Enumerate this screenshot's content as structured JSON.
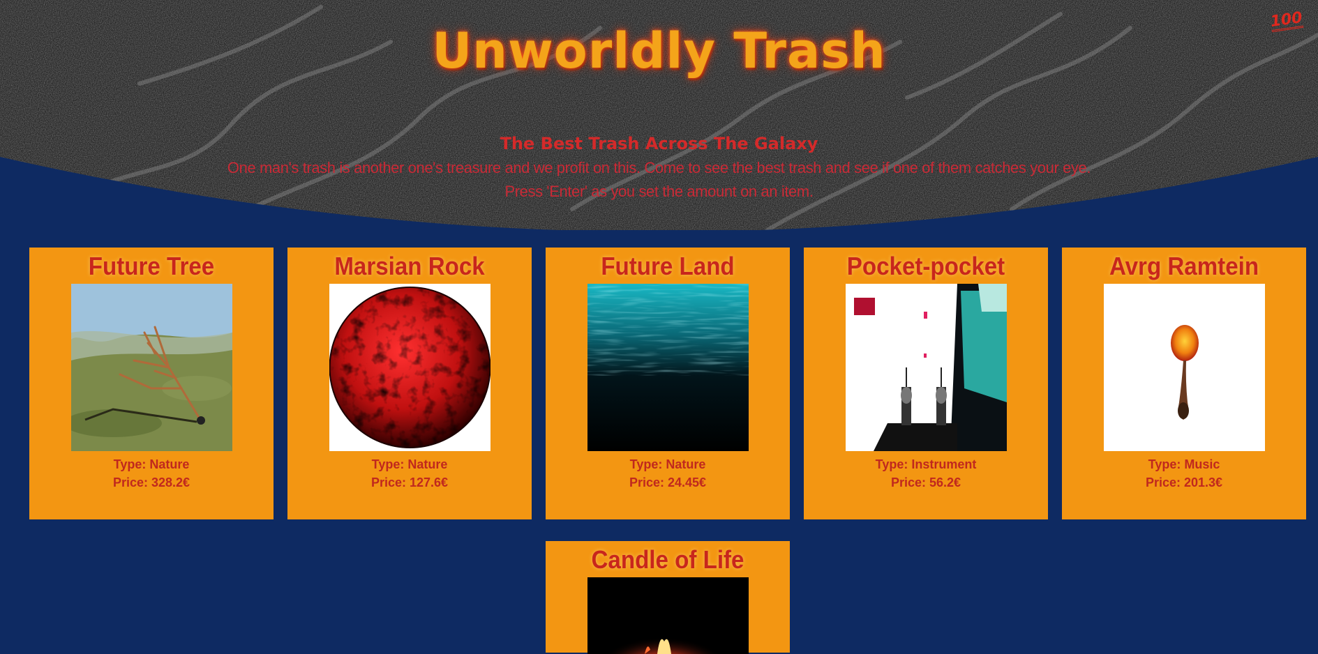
{
  "header": {
    "title": "Unworldly Trash",
    "badge": "100",
    "tagline": "The Best Trash Across The Galaxy",
    "description_line1": "One man's trash is another one's treasure and we profit on this. Come to see the best trash and see if one of them catches your eye.",
    "description_line2": "Press 'Enter' as you set the amount on an item."
  },
  "products": [
    {
      "name": "Future Tree",
      "type_label": "Type: Nature",
      "price_label": "Price: 328.2€",
      "image": "branch-on-shore"
    },
    {
      "name": "Marsian Rock",
      "type_label": "Type: Nature",
      "price_label": "Price: 127.6€",
      "image": "red-sphere"
    },
    {
      "name": "Future Land",
      "type_label": "Type: Nature",
      "price_label": "Price: 24.45€",
      "image": "dark-water"
    },
    {
      "name": "Pocket-pocket",
      "type_label": "Type: Instrument",
      "price_label": "Price: 56.2€",
      "image": "urinals-room"
    },
    {
      "name": "Avrg Ramtein",
      "type_label": "Type: Music",
      "price_label": "Price: 201.3€",
      "image": "orange-spoon"
    },
    {
      "name": "Candle of Life",
      "type_label": "",
      "price_label": "",
      "image": "candle-flame"
    }
  ],
  "colors": {
    "background": "#0e2a62",
    "card": "#f39612",
    "accent_red": "#c8261c",
    "title_orange": "#f4a41a"
  }
}
